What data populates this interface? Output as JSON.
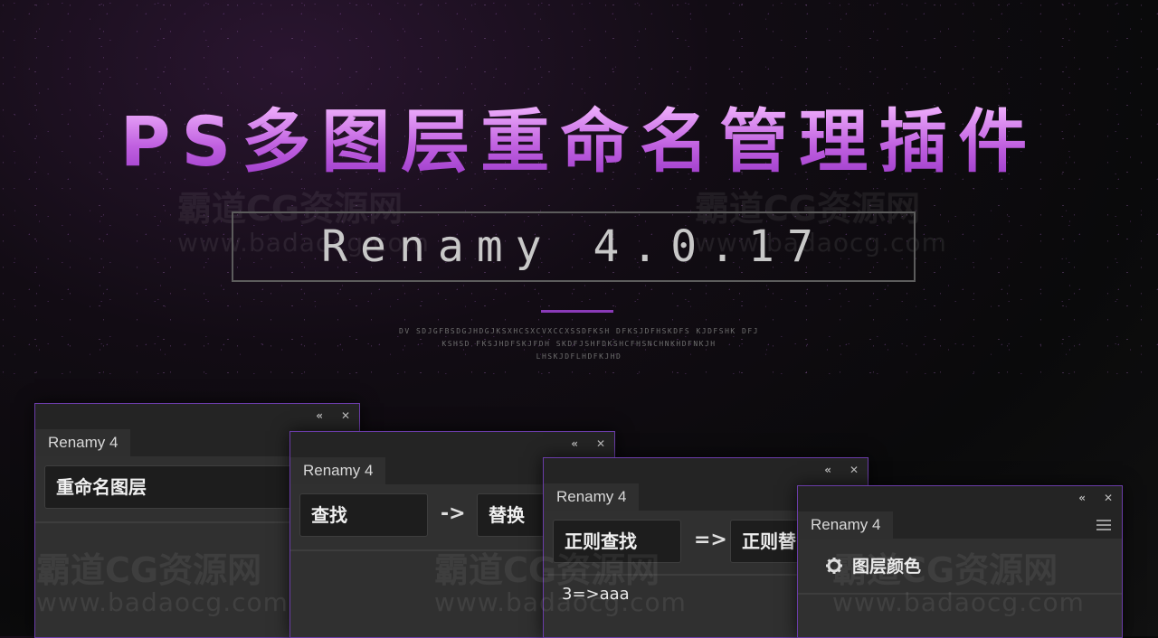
{
  "banner": {
    "title": "PS多图层重命名管理插件",
    "subtitle": "Renamy 4.0.17",
    "deco_lines": [
      "DV SDJGFBSDGJHDGJKSXHCSXCVXCCXSSDFKSH DFKSJDFHSKDFS KJDFSHK DFJ",
      "KSHSD FKSJHDFSKJFDH SKDFJSHFDKSHCFHSNCHNKHDFNKJH",
      "LHSKJDFLHDFKJHD"
    ]
  },
  "watermarks": {
    "name": "霸道CG资源网",
    "url": "www.badaocg.com"
  },
  "panels": [
    {
      "tab": "Renamy 4",
      "collapse_icon": "«",
      "close_icon": "✕",
      "field": "重命名图层"
    },
    {
      "tab": "Renamy 4",
      "collapse_icon": "«",
      "close_icon": "✕",
      "find": "查找",
      "arrow": "->",
      "replace": "替换"
    },
    {
      "tab": "Renamy 4",
      "collapse_icon": "«",
      "close_icon": "✕",
      "regex_find": "正则查找",
      "arrow": "=>",
      "regex_replace": "正则替",
      "example": "3=>aaa"
    },
    {
      "tab": "Renamy 4",
      "collapse_icon": "«",
      "close_icon": "✕",
      "menu_icon": "menu-icon",
      "gear_icon": "gear-icon",
      "option": "图层颜色"
    }
  ]
}
